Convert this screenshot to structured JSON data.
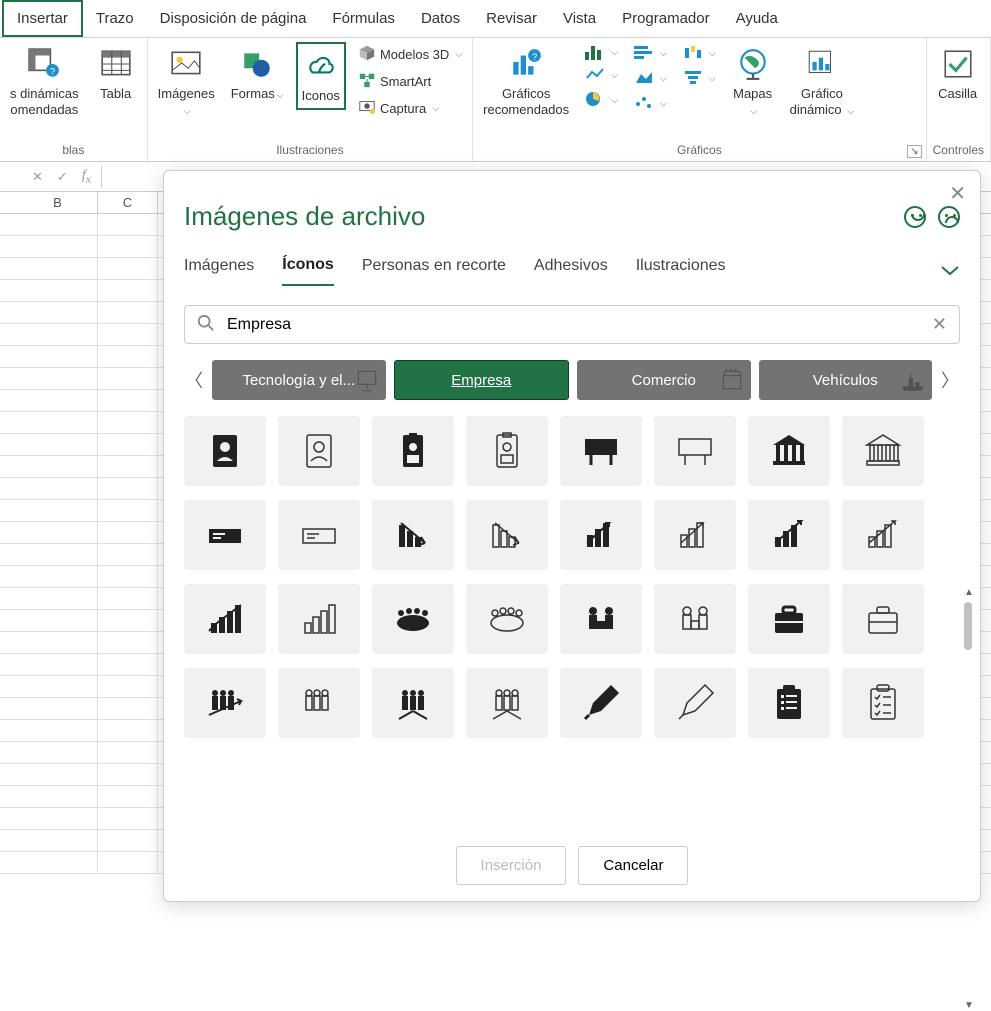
{
  "ribbon_tabs": {
    "insertar": "Insertar",
    "trazo": "Trazo",
    "disposicion": "Disposición de página",
    "formulas": "Fórmulas",
    "datos": "Datos",
    "revisar": "Revisar",
    "vista": "Vista",
    "programador": "Programador",
    "ayuda": "Ayuda"
  },
  "ribbon_groups": {
    "tablas": {
      "label": "blas",
      "dinamicas_line1": "s dinámicas",
      "dinamicas_line2": "omendadas",
      "tabla": "Tabla"
    },
    "ilustraciones": {
      "label": "Ilustraciones",
      "imagenes": "Imágenes",
      "formas": "Formas",
      "iconos": "Iconos",
      "modelos3d": "Modelos 3D",
      "smartart": "SmartArt",
      "captura": "Captura"
    },
    "graficos": {
      "label": "Gráficos",
      "recomendados_line1": "Gráficos",
      "recomendados_line2": "recomendados",
      "mapas": "Mapas",
      "dinamico_line1": "Gráfico",
      "dinamico_line2": "dinámico"
    },
    "controles": {
      "label": "Controles",
      "casilla": "Casilla"
    }
  },
  "grid": {
    "col_b": "B",
    "col_c": "C"
  },
  "dialog": {
    "title": "Imágenes de archivo",
    "tabs": {
      "imagenes": "Imágenes",
      "iconos": "Íconos",
      "personas": "Personas en recorte",
      "adhesivos": "Adhesivos",
      "ilustraciones": "Ilustraciones"
    },
    "search": {
      "value": "Empresa"
    },
    "categories": {
      "tecnologia": "Tecnología y el...",
      "empresa": "Empresa",
      "comercio": "Comercio",
      "vehiculos": "Vehículos"
    },
    "icon_tiles": {
      "r1": [
        "contact-card-solid",
        "contact-card-outline",
        "id-badge-solid",
        "id-badge-outline",
        "billboard-solid",
        "billboard-outline",
        "bank-solid",
        "bank-outline"
      ],
      "r2": [
        "cheque-solid",
        "cheque-outline",
        "bar-chart-down-solid",
        "bar-chart-down-outline",
        "bar-chart-trend-solid",
        "bar-chart-trend-outline",
        "bar-chart-up-solid",
        "bar-chart-up-outline"
      ],
      "r3": [
        "bar-chart-growth-solid",
        "bar-chart-growth-outline",
        "meeting-table-solid",
        "meeting-table-outline",
        "interview-solid",
        "interview-outline",
        "briefcase-solid",
        "briefcase-outline"
      ],
      "r4": [
        "team-arrow-solid",
        "team-outline",
        "team-split-solid",
        "team-split-outline",
        "pen-solid",
        "pen-outline",
        "clipboard-list-solid",
        "clipboard-list-outline"
      ]
    },
    "buttons": {
      "insertar": "Inserción",
      "cancelar": "Cancelar"
    }
  }
}
